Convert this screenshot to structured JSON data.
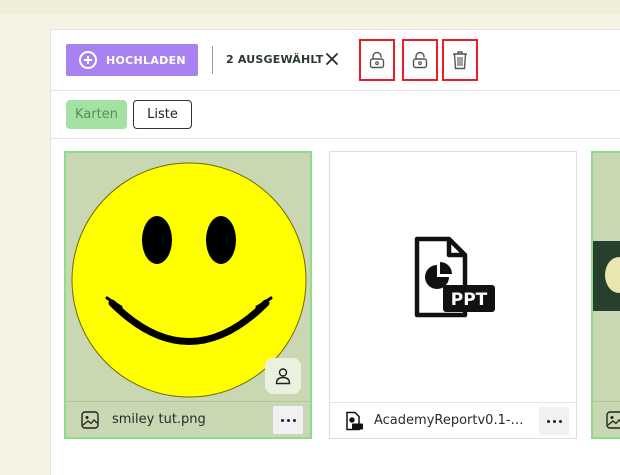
{
  "toolbar": {
    "upload_label": "HOCHLADEN",
    "selected_label": "2 AUSGEWÄHLT",
    "clear_icon": "close-icon",
    "actions": [
      {
        "icon": "unlock-icon"
      },
      {
        "icon": "unlock-icon"
      },
      {
        "icon": "trash-icon"
      }
    ],
    "accent_color": "#a882f0",
    "highlight_color": "#e81d2a"
  },
  "views": {
    "cards_label": "Karten",
    "list_label": "Liste",
    "active": "Karten"
  },
  "files": [
    {
      "name": "smiley tut.png",
      "type": "image",
      "selected": true,
      "icon": "image-icon",
      "badge_icon": "user-icon"
    },
    {
      "name": "AcademyReportv0.1-52...",
      "type": "ppt",
      "selected": false,
      "icon": "ppt-file-icon",
      "preview_text": "PPT"
    },
    {
      "name": "",
      "type": "image",
      "selected": true,
      "icon": "image-icon"
    }
  ]
}
